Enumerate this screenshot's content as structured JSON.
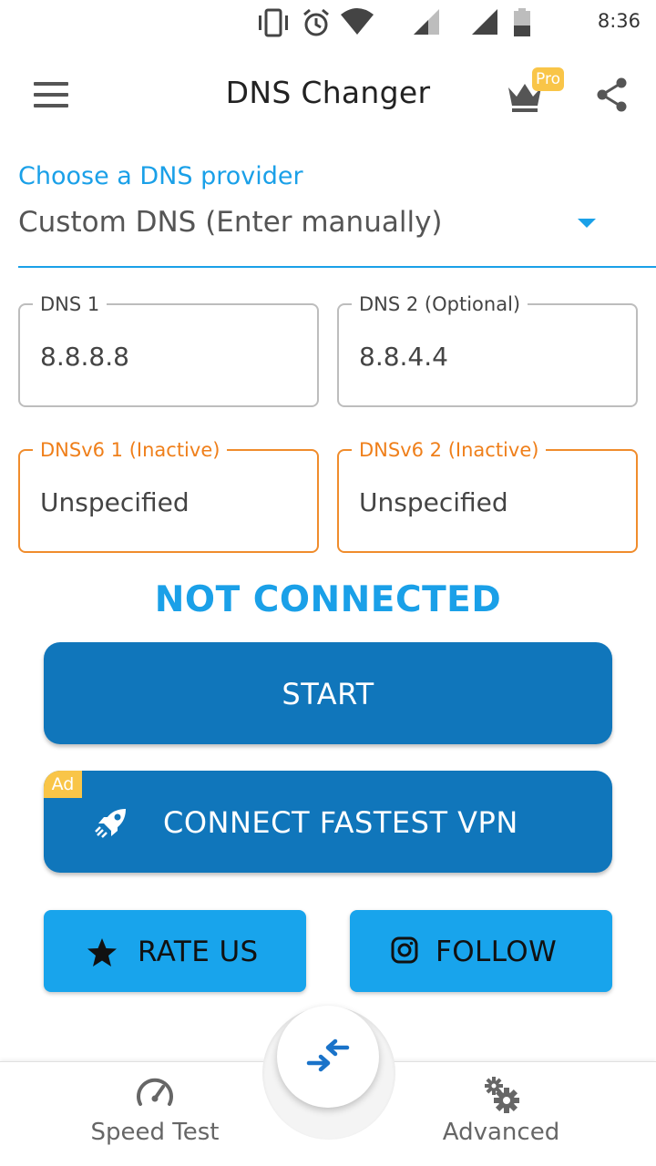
{
  "status_bar": {
    "time": "8:36",
    "icons": [
      "vibrate-icon",
      "alarm-icon",
      "wifi-icon",
      "signal-icon",
      "signal-icon",
      "battery-icon"
    ]
  },
  "app_bar": {
    "title": "DNS Changer",
    "pro_badge": "Pro",
    "icons": {
      "menu": "menu-icon",
      "pro": "crown-icon",
      "share": "share-icon"
    }
  },
  "provider_select": {
    "label": "Choose a DNS provider",
    "selected": "Custom DNS (Enter manually)"
  },
  "fields": {
    "dns1": {
      "label": "DNS 1",
      "value": "8.8.8.8"
    },
    "dns2": {
      "label": "DNS 2 (Optional)",
      "value": "8.8.4.4"
    },
    "dnsv6_1": {
      "label": "DNSv6 1 (Inactive)",
      "value": "Unspecified"
    },
    "dnsv6_2": {
      "label": "DNSv6 2 (Inactive)",
      "value": "Unspecified"
    }
  },
  "connection_status": "NOT CONNECTED",
  "buttons": {
    "start": "START",
    "vpn": "CONNECT FASTEST VPN",
    "vpn_ad_badge": "Ad",
    "rate": "RATE US",
    "follow": "FOLLOW"
  },
  "bottom_nav": {
    "speed_test": "Speed Test",
    "advanced": "Advanced"
  },
  "colors": {
    "accent": "#1aa0e8",
    "primary_button": "#1076bb",
    "secondary_button": "#18a4ec",
    "inactive_field": "#f08c2c",
    "badge": "#f9c548"
  }
}
